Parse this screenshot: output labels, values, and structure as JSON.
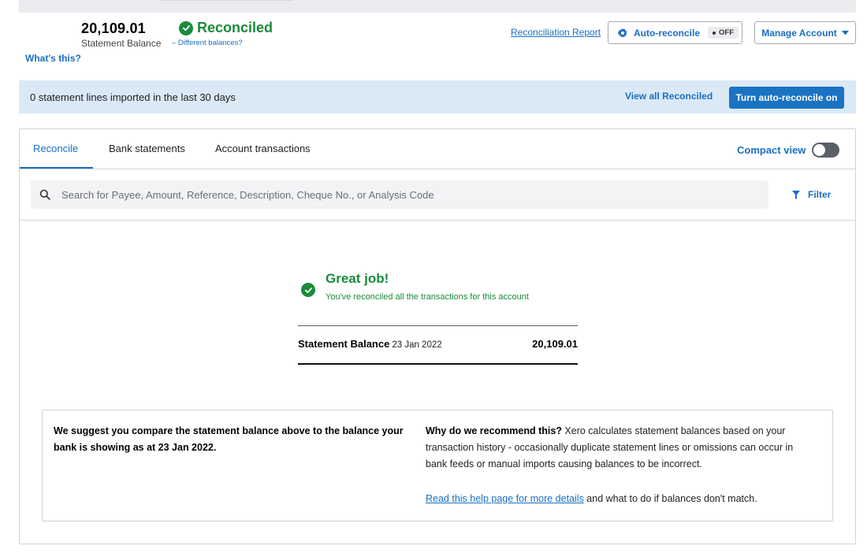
{
  "header": {
    "statement_balance_value": "20,109.01",
    "statement_balance_label": "Statement Balance",
    "whats_this": "What's this?",
    "status": "Reconciled",
    "different_balances": "– Different balances?",
    "reconciliation_report": "Reconciliation Report",
    "auto_reconcile_label": "Auto-reconcile",
    "auto_reconcile_state": "OFF",
    "manage_account": "Manage Account"
  },
  "info_bar": {
    "message": "0 statement lines imported in the last 30 days",
    "view_all": "View all Reconciled",
    "turn_on": "Turn auto-reconcile on"
  },
  "tabs": [
    {
      "label": "Reconcile",
      "active": true
    },
    {
      "label": "Bank statements",
      "active": false
    },
    {
      "label": "Account transactions",
      "active": false
    }
  ],
  "compact_view": {
    "label": "Compact view",
    "on": false
  },
  "search": {
    "placeholder": "Search for Payee, Amount, Reference, Description, Cheque No., or Analysis Code",
    "filter_label": "Filter"
  },
  "success": {
    "title": "Great job!",
    "subtitle": "You've reconciled all the transactions for this account"
  },
  "statement_summary": {
    "label": "Statement Balance",
    "date": "23 Jan 2022",
    "value": "20,109.01"
  },
  "suggestion": {
    "left_text": "We suggest you compare the statement balance above to the balance your bank is showing as at 23 Jan 2022.",
    "why_title": "Why do we recommend this?",
    "why_text": " Xero calculates statement balances based on your transaction history - occasionally duplicate statement lines or omissions can occur in bank feeds or manual imports causing balances to be incorrect.",
    "help_link": "Read this help page for more details",
    "help_suffix": " and what to do if balances don't match."
  },
  "colors": {
    "accent_blue": "#1a6ec2",
    "success_green": "#1a8a3a",
    "info_bar_bg": "#dbe9f6",
    "primary_button": "#1a73c2"
  },
  "icons": {
    "status": "check-circle-icon",
    "auto_reconcile": "gear-icon",
    "manage_dropdown": "caret-down-icon",
    "search": "search-icon",
    "filter": "filter-icon"
  }
}
